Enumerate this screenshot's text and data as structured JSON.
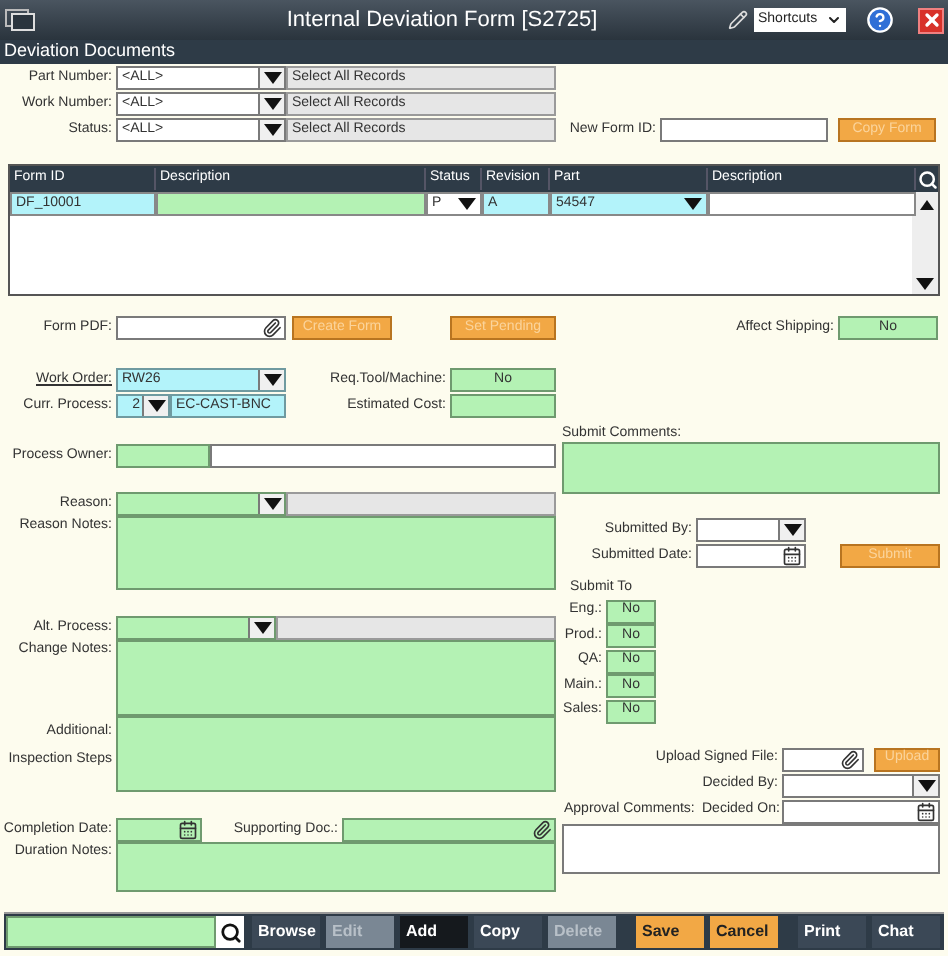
{
  "window": {
    "title": "Internal Deviation Form [S2725]",
    "shortcuts": "Shortcuts"
  },
  "section": "Deviation Documents",
  "filters": [
    {
      "label": "Part Number:",
      "value": "<ALL>",
      "description": "Select All Records"
    },
    {
      "label": "Work Number:",
      "value": "<ALL>",
      "description": "Select All Records"
    },
    {
      "label": "Status:",
      "value": "<ALL>",
      "description": "Select All Records"
    }
  ],
  "new_form": {
    "label": "New Form ID:",
    "button": {
      "label": "Copy Form",
      "disabled": true
    }
  },
  "grid": {
    "columns": [
      "Form ID",
      "Description",
      "Status",
      "Revision",
      "Part",
      "Description"
    ],
    "rows": [
      {
        "form_id": "DF_10001",
        "status": "P",
        "revision": "A",
        "part": "54547"
      }
    ]
  },
  "form_pdf": {
    "label": "Form PDF:"
  },
  "create_form": {
    "label": "Create Form",
    "disabled": true
  },
  "set_pending": {
    "label": "Set Pending",
    "disabled": true
  },
  "affect_shipping": {
    "label": "Affect Shipping:",
    "value": "No"
  },
  "work_order": {
    "label": "Work Order:",
    "value": "RW26"
  },
  "curr_process": {
    "label": "Curr. Process:",
    "step": "2",
    "process": "EC-CAST-BNC"
  },
  "req_tool": {
    "label": "Req.Tool/Machine:",
    "value": "No"
  },
  "estimated_cost": {
    "label": "Estimated Cost:"
  },
  "submit_comments": {
    "label": "Submit Comments:"
  },
  "process_owner": {
    "label": "Process Owner:"
  },
  "reason": {
    "label": "Reason:"
  },
  "reason_notes": {
    "label": "Reason Notes:"
  },
  "submitted_by": {
    "label": "Submitted By:"
  },
  "submitted_date": {
    "label": "Submitted Date:"
  },
  "submit": {
    "label": "Submit",
    "disabled": true
  },
  "submit_to": {
    "title": "Submit To",
    "items": [
      {
        "label": "Eng.:",
        "value": "No"
      },
      {
        "label": "Prod.:",
        "value": "No"
      },
      {
        "label": "QA:",
        "value": "No"
      },
      {
        "label": "Main.:",
        "value": "No"
      },
      {
        "label": "Sales:",
        "value": "No"
      }
    ]
  },
  "alt_process": {
    "label": "Alt. Process:"
  },
  "change_notes": {
    "label": "Change Notes:"
  },
  "additional": {
    "label": "Additional:",
    "label_2": "Inspection Steps"
  },
  "upload": {
    "label": "Upload Signed File:",
    "button": {
      "label": "Upload",
      "disabled": true
    }
  },
  "decided_by": {
    "label": "Decided By:"
  },
  "completion_date": {
    "label": "Completion Date:"
  },
  "supporting_doc": {
    "label": "Supporting Doc.:"
  },
  "approval_comments": {
    "label": "Approval Comments:"
  },
  "decided_on": {
    "label": "Decided On:"
  },
  "duration_notes": {
    "label": "Duration Notes:"
  },
  "toolbar": {
    "groups": [
      [
        {
          "label": "Browse",
          "kind": "nav",
          "disabled": false,
          "selected": false
        },
        {
          "label": "Edit",
          "kind": "nav",
          "disabled": true,
          "selected": false
        },
        {
          "label": "Add",
          "kind": "nav",
          "disabled": false,
          "selected": true
        },
        {
          "label": "Copy",
          "kind": "nav",
          "disabled": false,
          "selected": false
        },
        {
          "label": "Delete",
          "kind": "nav",
          "disabled": true,
          "selected": false
        }
      ],
      [
        {
          "label": "Save",
          "kind": "action",
          "disabled": false,
          "selected": false
        },
        {
          "label": "Cancel",
          "kind": "action",
          "disabled": false,
          "selected": false
        }
      ],
      [
        {
          "label": "Print",
          "kind": "nav",
          "disabled": false,
          "selected": false
        },
        {
          "label": "Chat",
          "kind": "nav",
          "disabled": false,
          "selected": false
        }
      ]
    ]
  }
}
